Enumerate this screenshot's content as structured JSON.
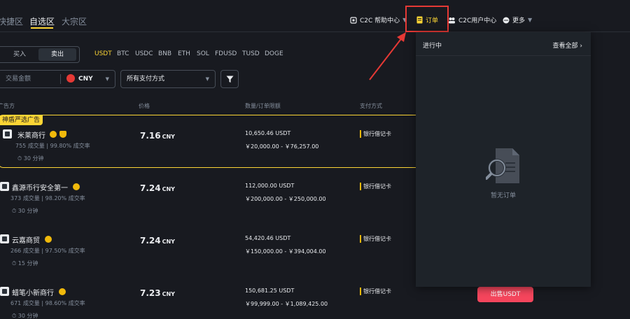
{
  "top_tabs": [
    {
      "label": "快捷区"
    },
    {
      "label": "自选区"
    },
    {
      "label": "大宗区"
    }
  ],
  "nav": {
    "help_center": "C2C 帮助中心",
    "orders": "订单",
    "user_center": "C2C用户中心",
    "more": "更多"
  },
  "trade_toggle": {
    "buy": "买入",
    "sell": "卖出",
    "selected": "卖出"
  },
  "coins": [
    "USDT",
    "BTC",
    "USDC",
    "BNB",
    "ETH",
    "SOL",
    "FDUSD",
    "TUSD",
    "DOGE"
  ],
  "filters": {
    "amount_placeholder": "交易金额",
    "currency": "CNY",
    "payment": "所有支付方式"
  },
  "table_headers": {
    "advertiser": "广告方",
    "price": "价格",
    "quantity_limit": "数量/订单限额",
    "payment": "支付方式"
  },
  "featured_label": "神盾严选广告",
  "ads": [
    {
      "name": "米莱商行",
      "orders": "755 成交量",
      "completion": "99.80% 成交率",
      "time": "30 分钟",
      "price": "7.16",
      "currency": "CNY",
      "quantity": "10,650.46 USDT",
      "limit": "￥20,000.00 - ￥76,257.00",
      "payment": "银行借记卡"
    },
    {
      "name": "鑫源币行安全第一",
      "orders": "373 成交量",
      "completion": "98.20% 成交率",
      "time": "30 分钟",
      "price": "7.24",
      "currency": "CNY",
      "quantity": "112,000.00 USDT",
      "limit": "￥200,000.00 - ￥250,000.00",
      "payment": "银行借记卡"
    },
    {
      "name": "云嘉商贸",
      "orders": "266 成交量",
      "completion": "97.50% 成交率",
      "time": "15 分钟",
      "price": "7.24",
      "currency": "CNY",
      "quantity": "54,420.46 USDT",
      "limit": "￥150,000.00 - ￥394,004.00",
      "payment": "银行借记卡"
    },
    {
      "name": "蜡笔小新商行",
      "orders": "671 成交量",
      "completion": "98.60% 成交率",
      "time": "30 分钟",
      "price": "7.23",
      "currency": "CNY",
      "quantity": "150,681.25 USDT",
      "limit": "￥99,999.00 - ￥1,089,425.00",
      "payment": "银行借记卡"
    }
  ],
  "sell_button": "出售USDT",
  "orders_panel": {
    "title": "进行中",
    "view_all": "查看全部",
    "empty": "暂无订单"
  },
  "colors": {
    "background": "#181a20",
    "panel": "#1e2329",
    "accent": "#fcd535",
    "sell": "#f6465d",
    "highlight_box": "#e53935",
    "arrow": "#e53935"
  }
}
